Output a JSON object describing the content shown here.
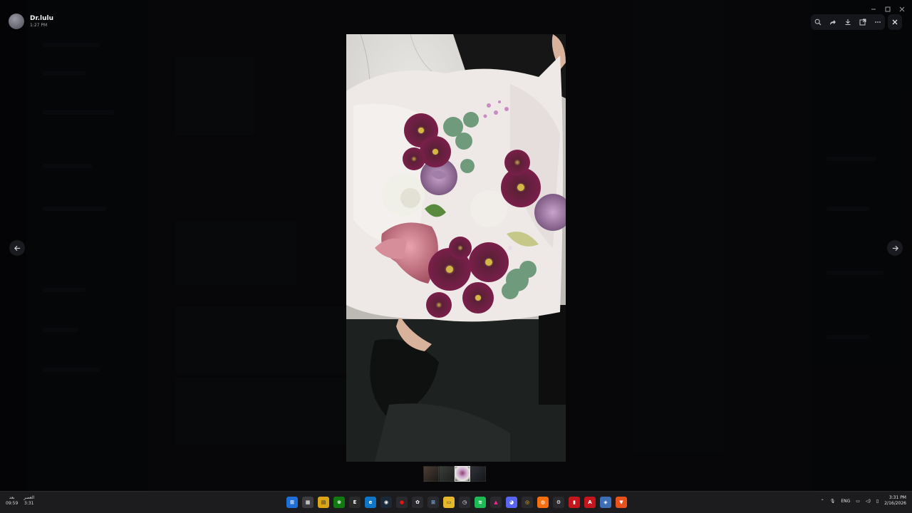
{
  "viewer": {
    "uploader_name": "Dr.lulu",
    "uploader_time": "1:27 PM"
  },
  "toolbar": {
    "icons": [
      "zoom-icon",
      "forward-icon",
      "download-icon",
      "open-external-icon",
      "more-icon"
    ],
    "close_icon": "close-icon"
  },
  "navigation": {
    "prev_icon": "arrow-left-icon",
    "next_icon": "arrow-right-icon"
  },
  "thumbnails": {
    "count": 4,
    "active_index": 2
  },
  "taskbar": {
    "left_top": "بعد",
    "left_bottom": "09:59",
    "left2_top": "العصر",
    "left2_bottom": "3:31",
    "apps": [
      "windows-start",
      "widgets",
      "notes",
      "xbox",
      "epic",
      "edge",
      "steam",
      "media",
      "chatgpt",
      "spreadsheet",
      "file-explorer",
      "clock",
      "spotify",
      "vlc",
      "discord",
      "chrome",
      "messenger",
      "settings",
      "cursor",
      "adobe",
      "vpn",
      "brave"
    ],
    "tray_lang": "ENG",
    "clock_time": "3:31 PM",
    "clock_date": "2/16/2026"
  },
  "colors": {
    "overlay": "#000000",
    "toolbar_bg": "#16171c",
    "taskbar_bg": "#1c1c1f"
  }
}
